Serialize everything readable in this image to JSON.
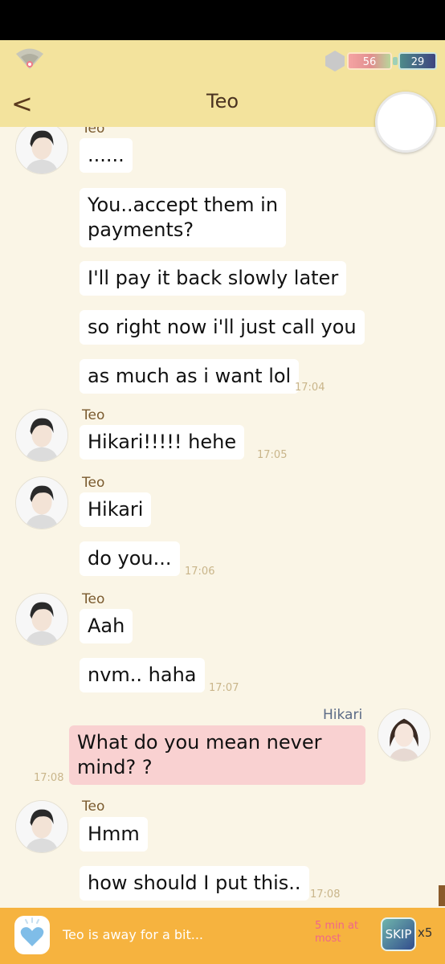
{
  "topbar": {
    "energy_1": "56",
    "energy_2": "29"
  },
  "header": {
    "back_label": "<",
    "title": "Teo"
  },
  "chat": {
    "partial_sender": "Teo",
    "messages": [
      {
        "sender": "Teo",
        "text": "......"
      },
      {
        "text": "You..accept them in\npayments?"
      },
      {
        "text": "I'll pay it back slowly later"
      },
      {
        "text": "so right now i'll just call you"
      },
      {
        "text": "as much as i want lol",
        "time": "17:04"
      },
      {
        "sender": "Teo",
        "text": "Hikari!!!!! hehe",
        "time": "17:05"
      },
      {
        "sender": "Teo",
        "text": "Hikari"
      },
      {
        "text": "do you...",
        "time": "17:06"
      },
      {
        "sender": "Teo",
        "text": "Aah"
      },
      {
        "text": "nvm.. haha",
        "time": "17:07"
      },
      {
        "sender": "Hikari",
        "text": "What do you mean never\nmind? ?",
        "time": "17:08"
      },
      {
        "sender": "Teo",
        "text": "Hmm"
      },
      {
        "text": "how should I put this..",
        "time": "17:08"
      }
    ]
  },
  "bottom": {
    "away_text": "Teo is away for a bit...",
    "wait_text": "5 min at most",
    "skip_label": "SKIP",
    "skip_count": "x5"
  },
  "colors": {
    "header_bg": "#f3e39d",
    "chat_bg": "#faf5e6",
    "bottom_bg": "#f6b33f",
    "my_bubble": "#f9d1d1"
  }
}
